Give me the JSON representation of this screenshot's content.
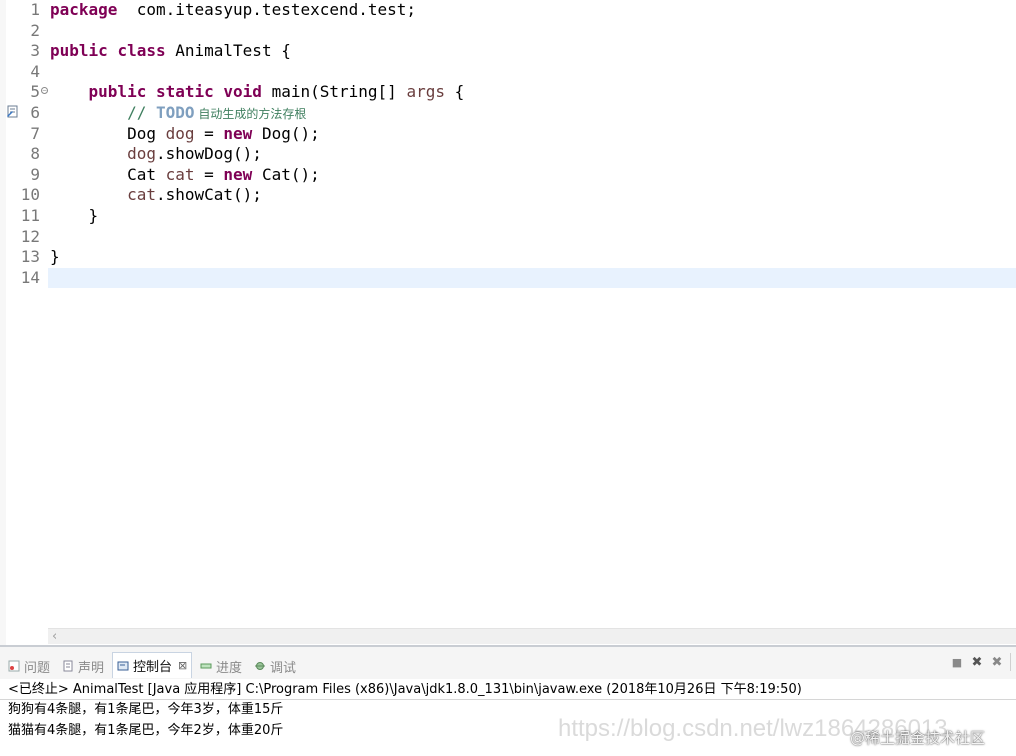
{
  "editor": {
    "lines": [
      {
        "no": "1",
        "parts": [
          [
            "kw",
            "package"
          ],
          [
            "",
            "  com.iteasyup.testexcend.test;"
          ]
        ]
      },
      {
        "no": "2",
        "parts": []
      },
      {
        "no": "3",
        "parts": [
          [
            "kw",
            "public"
          ],
          [
            "",
            " "
          ],
          [
            "kw",
            "class"
          ],
          [
            "",
            " AnimalTest {"
          ]
        ]
      },
      {
        "no": "4",
        "parts": []
      },
      {
        "no": "5",
        "parts": [
          [
            "",
            "    "
          ],
          [
            "kw",
            "public"
          ],
          [
            "",
            " "
          ],
          [
            "kw",
            "static"
          ],
          [
            "",
            " "
          ],
          [
            "kw",
            "void"
          ],
          [
            "",
            " main(String[] "
          ],
          [
            "var",
            "args"
          ],
          [
            "",
            " {"
          ]
        ]
      },
      {
        "no": "6",
        "parts": [
          [
            "cmt",
            "        // "
          ],
          [
            "todo",
            "TODO"
          ],
          [
            "cmt cjk",
            " 自动生成的方法存根"
          ]
        ]
      },
      {
        "no": "7",
        "parts": [
          [
            "",
            "        Dog "
          ],
          [
            "var",
            "dog"
          ],
          [
            "",
            " = "
          ],
          [
            "kw",
            "new"
          ],
          [
            "",
            " Dog();"
          ]
        ]
      },
      {
        "no": "8",
        "parts": [
          [
            "var",
            "        dog"
          ],
          [
            "",
            ".showDog();"
          ]
        ]
      },
      {
        "no": "9",
        "parts": [
          [
            "",
            "        Cat "
          ],
          [
            "var",
            "cat"
          ],
          [
            "",
            " = "
          ],
          [
            "kw",
            "new"
          ],
          [
            "",
            " Cat();"
          ]
        ]
      },
      {
        "no": "10",
        "parts": [
          [
            "var",
            "        cat"
          ],
          [
            "",
            ".showCat();"
          ]
        ]
      },
      {
        "no": "11",
        "parts": [
          [
            "",
            "    }"
          ]
        ]
      },
      {
        "no": "12",
        "parts": []
      },
      {
        "no": "13",
        "parts": [
          [
            "",
            "}"
          ]
        ]
      },
      {
        "no": "14",
        "parts": []
      }
    ],
    "current_line": "14"
  },
  "console": {
    "tabs": [
      {
        "label": "问题",
        "icon": "problems-icon",
        "active": false
      },
      {
        "label": "声明",
        "icon": "declaration-icon",
        "active": false
      },
      {
        "label": "控制台",
        "icon": "console-icon",
        "active": true,
        "close": "⊠"
      },
      {
        "label": "进度",
        "icon": "progress-icon",
        "active": false
      },
      {
        "label": "调试",
        "icon": "debug-icon",
        "active": false
      }
    ],
    "toolbar": {
      "stop": "■",
      "remove": "✖",
      "remove_all": "✖"
    },
    "terminated_line": "<已终止> AnimalTest [Java 应用程序] C:\\Program Files (x86)\\Java\\jdk1.8.0_131\\bin\\javaw.exe  (2018年10月26日 下午8:19:50)",
    "output": [
      "狗狗有4条腿，有1条尾巴，今年3岁，体重15斤",
      "猫猫有4条腿，有1条尾巴，今年2岁，体重20斤"
    ]
  },
  "watermarks": {
    "blog": "https://blog.csdn.net/lwz1864286013",
    "juejin": "@稀土掘金技术社区"
  },
  "colors": {
    "keyword": "#7f0055",
    "variable": "#6a3e3e",
    "comment": "#3f7f5f",
    "todo": "#7f9fbf",
    "current_line_highlight": "#e8f2fe"
  }
}
